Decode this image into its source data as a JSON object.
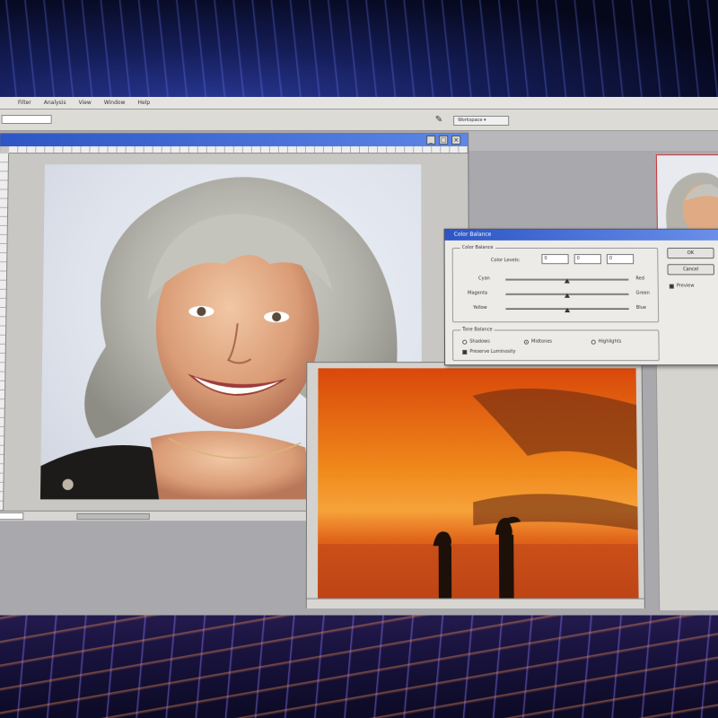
{
  "menubar": {
    "items": [
      "",
      "Filter",
      "Analysis",
      "View",
      "Window",
      "Help"
    ]
  },
  "optionsbar": {
    "workspace_label": "Workspace ▾",
    "brush_icon": "brush-icon"
  },
  "doc1": {
    "title": "",
    "win_buttons": [
      "_",
      "□",
      "×"
    ]
  },
  "dialog": {
    "title": "Color Balance",
    "balance_group_label": "Color Balance",
    "levels_label": "Color Levels:",
    "levels": [
      "0",
      "0",
      "0"
    ],
    "sliders": [
      {
        "left": "Cyan",
        "right": "Red",
        "value": 0
      },
      {
        "left": "Magenta",
        "right": "Green",
        "value": 0
      },
      {
        "left": "Yellow",
        "right": "Blue",
        "value": 0
      }
    ],
    "tone_group_label": "Tone Balance",
    "tones": [
      {
        "label": "Shadows",
        "selected": false
      },
      {
        "label": "Midtones",
        "selected": true
      },
      {
        "label": "Highlights",
        "selected": false
      }
    ],
    "preserve_label": "Preserve Luminosity",
    "preserve_checked": true,
    "ok_label": "OK",
    "cancel_label": "Cancel",
    "preview_label": "Preview",
    "preview_checked": true
  },
  "colors": {
    "titlebar": "#2d55c4",
    "workspace": "#a9a9ad",
    "sunset_orange": "#e85c10"
  }
}
